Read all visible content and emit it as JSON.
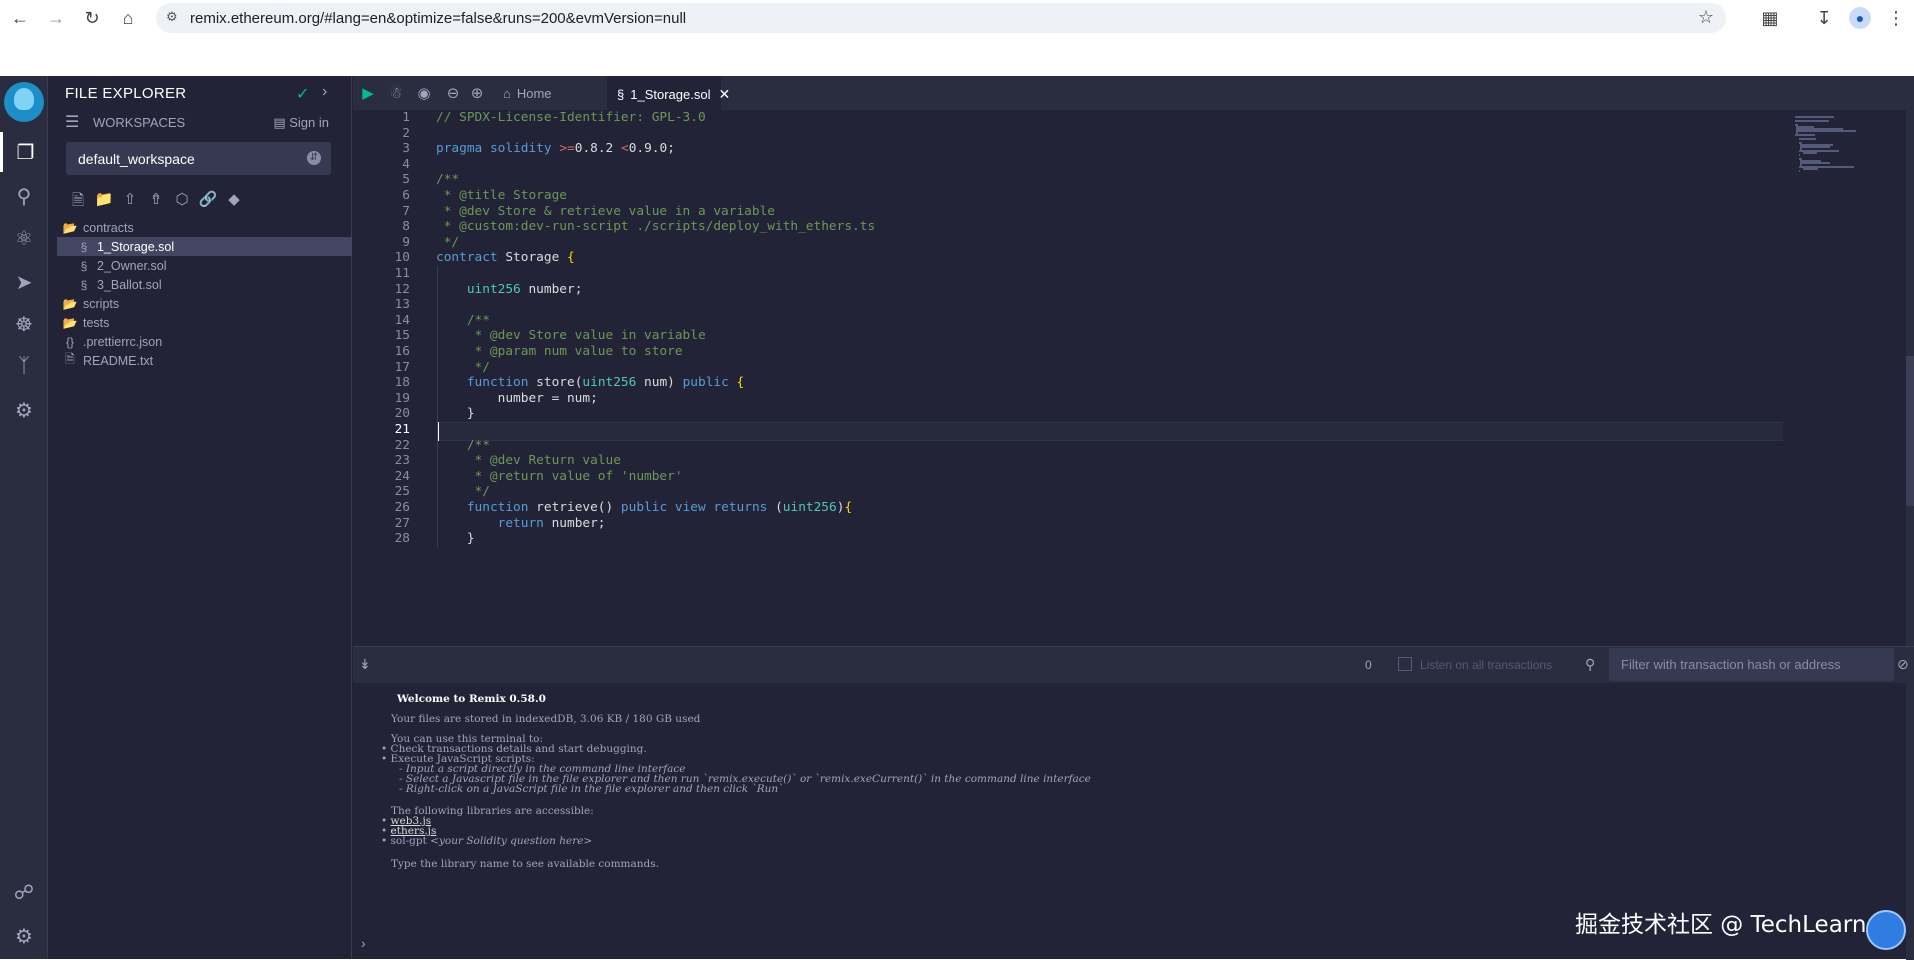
{
  "browser": {
    "url": "remix.ethereum.org/#lang=en&optimize=false&runs=200&evmVersion=null"
  },
  "side_panel": {
    "title": "FILE EXPLORER",
    "workspaces_label": "WORKSPACES",
    "sign_in": "Sign in",
    "workspace_name": "default_workspace",
    "tree": [
      {
        "label": "contracts",
        "type": "folder",
        "level": 0
      },
      {
        "label": "1_Storage.sol",
        "type": "sol",
        "level": 1,
        "selected": true
      },
      {
        "label": "2_Owner.sol",
        "type": "sol",
        "level": 1
      },
      {
        "label": "3_Ballot.sol",
        "type": "sol",
        "level": 1
      },
      {
        "label": "scripts",
        "type": "folder",
        "level": 0
      },
      {
        "label": "tests",
        "type": "folder",
        "level": 0
      },
      {
        "label": ".prettierrc.json",
        "type": "json",
        "level": 0
      },
      {
        "label": "README.txt",
        "type": "file",
        "level": 0
      }
    ]
  },
  "editor": {
    "tabs": [
      {
        "label": "Home",
        "active": false
      },
      {
        "label": "1_Storage.sol",
        "active": true
      }
    ],
    "current_line": 21,
    "lines": [
      "// SPDX-License-Identifier: GPL-3.0",
      "",
      "pragma solidity >=0.8.2 <0.9.0;",
      "",
      "/**",
      " * @title Storage",
      " * @dev Store & retrieve value in a variable",
      " * @custom:dev-run-script ./scripts/deploy_with_ethers.ts",
      " */",
      "contract Storage {",
      "",
      "    uint256 number;",
      "",
      "    /**",
      "     * @dev Store value in variable",
      "     * @param num value to store",
      "     */",
      "    function store(uint256 num) public {",
      "        number = num;",
      "    }",
      "",
      "    /**",
      "     * @dev Return value",
      "     * @return value of 'number'",
      "     */",
      "    function retrieve() public view returns (uint256){",
      "        return number;",
      "    }"
    ]
  },
  "terminal": {
    "tx_count": "0",
    "listen_label": "Listen on all transactions",
    "filter_placeholder": "Filter with transaction hash or address",
    "welcome": "Welcome to Remix 0.58.0",
    "storage_info": "Your files are stored in indexedDB, 3.06 KB / 180 GB used",
    "use_intro": "You can use this terminal to:",
    "bullet1": "Check transactions details and start debugging.",
    "bullet2": "Execute JavaScript scripts:",
    "sub1": "- Input a script directly in the command line interface",
    "sub2": "- Select a Javascript file in the file explorer and then run `remix.execute()` or `remix.exeCurrent()`  in the command line interface",
    "sub3": "- Right-click on a JavaScript file in the file explorer and then click `Run`",
    "libs_intro": "The following libraries are accessible:",
    "lib1": "web3.js",
    "lib2": "ethers.js",
    "lib3": "sol-gpt",
    "lib3_hint": "<your Solidity question here>",
    "type_hint": "Type the library name to see available commands."
  },
  "watermark": "掘金技术社区 @ TechLearn"
}
